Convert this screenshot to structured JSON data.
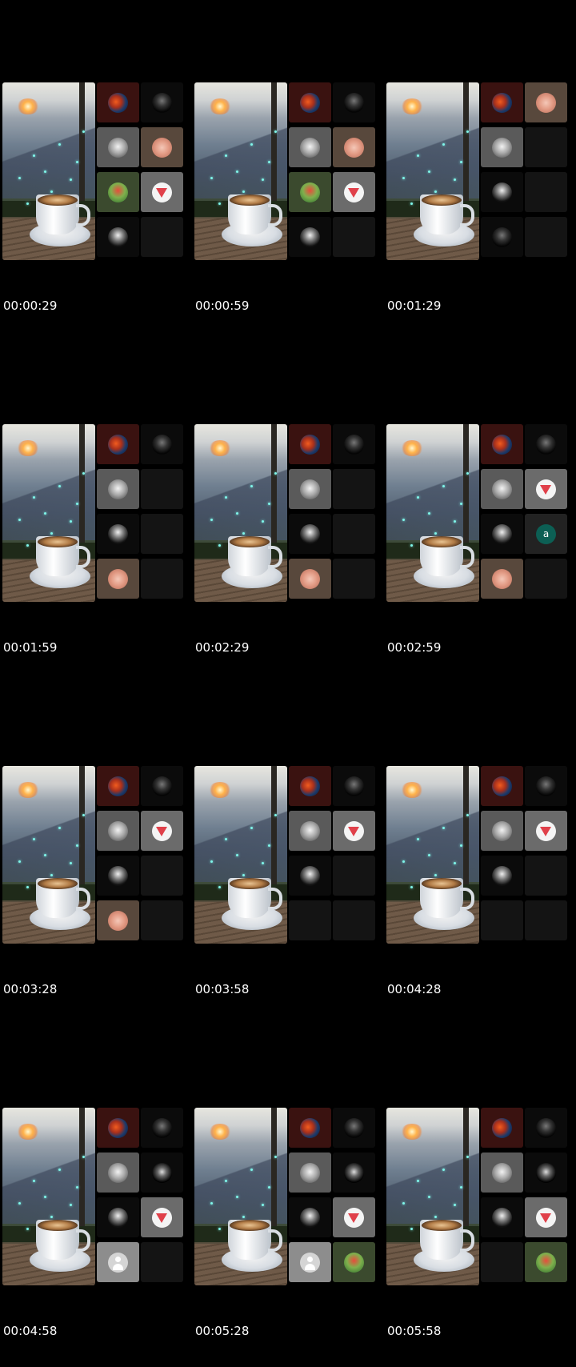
{
  "frames": [
    {
      "timestamp": "00:00:29",
      "tiles": [
        {
          "avatar": "mask",
          "style": "red-tile"
        },
        {
          "avatar": "dark",
          "style": "dark-tile"
        },
        {
          "avatar": "oldman",
          "style": "grey-tile"
        },
        {
          "avatar": "pig",
          "style": "pig-tile"
        },
        {
          "avatar": "mario",
          "style": "mario-tile"
        },
        {
          "avatar": "red",
          "style": "red2-tile"
        },
        {
          "avatar": "girl",
          "style": "dark-tile"
        },
        {
          "avatar": "",
          "style": ""
        }
      ]
    },
    {
      "timestamp": "00:00:59",
      "tiles": [
        {
          "avatar": "mask",
          "style": "red-tile"
        },
        {
          "avatar": "dark",
          "style": "dark-tile"
        },
        {
          "avatar": "oldman",
          "style": "grey-tile"
        },
        {
          "avatar": "pig",
          "style": "pig-tile"
        },
        {
          "avatar": "mario",
          "style": "mario-tile"
        },
        {
          "avatar": "red",
          "style": "red2-tile"
        },
        {
          "avatar": "girl",
          "style": "dark-tile"
        },
        {
          "avatar": "",
          "style": ""
        }
      ]
    },
    {
      "timestamp": "00:01:29",
      "tiles": [
        {
          "avatar": "mask",
          "style": "red-tile"
        },
        {
          "avatar": "pig",
          "style": "pig-tile"
        },
        {
          "avatar": "oldman",
          "style": "grey-tile"
        },
        {
          "avatar": "",
          "style": ""
        },
        {
          "avatar": "girl",
          "style": "dark-tile"
        },
        {
          "avatar": "",
          "style": ""
        },
        {
          "avatar": "dark",
          "style": "dark-tile"
        },
        {
          "avatar": "",
          "style": ""
        }
      ]
    },
    {
      "timestamp": "00:01:59",
      "tiles": [
        {
          "avatar": "mask",
          "style": "red-tile"
        },
        {
          "avatar": "dark",
          "style": "dark-tile"
        },
        {
          "avatar": "oldman",
          "style": "grey-tile"
        },
        {
          "avatar": "",
          "style": ""
        },
        {
          "avatar": "girl",
          "style": "dark-tile"
        },
        {
          "avatar": "",
          "style": ""
        },
        {
          "avatar": "pig",
          "style": "pig-tile"
        },
        {
          "avatar": "",
          "style": ""
        }
      ]
    },
    {
      "timestamp": "00:02:29",
      "tiles": [
        {
          "avatar": "mask",
          "style": "red-tile"
        },
        {
          "avatar": "dark",
          "style": "dark-tile"
        },
        {
          "avatar": "oldman",
          "style": "grey-tile"
        },
        {
          "avatar": "",
          "style": ""
        },
        {
          "avatar": "girl",
          "style": "dark-tile"
        },
        {
          "avatar": "",
          "style": ""
        },
        {
          "avatar": "pig",
          "style": "pig-tile"
        },
        {
          "avatar": "",
          "style": ""
        }
      ]
    },
    {
      "timestamp": "00:02:59",
      "tiles": [
        {
          "avatar": "mask",
          "style": "red-tile"
        },
        {
          "avatar": "dark",
          "style": "dark-tile"
        },
        {
          "avatar": "oldman",
          "style": "grey-tile"
        },
        {
          "avatar": "red",
          "style": "red2-tile"
        },
        {
          "avatar": "girl",
          "style": "dark-tile"
        },
        {
          "avatar": "letter",
          "label": "a",
          "style": "letter-tile"
        },
        {
          "avatar": "pig",
          "style": "pig-tile"
        },
        {
          "avatar": "",
          "style": ""
        }
      ]
    },
    {
      "timestamp": "00:03:28",
      "tiles": [
        {
          "avatar": "mask",
          "style": "red-tile"
        },
        {
          "avatar": "dark",
          "style": "dark-tile"
        },
        {
          "avatar": "oldman",
          "style": "grey-tile"
        },
        {
          "avatar": "red",
          "style": "red2-tile"
        },
        {
          "avatar": "girl",
          "style": "dark-tile"
        },
        {
          "avatar": "",
          "style": ""
        },
        {
          "avatar": "pig",
          "style": "pig-tile"
        },
        {
          "avatar": "",
          "style": ""
        }
      ]
    },
    {
      "timestamp": "00:03:58",
      "tiles": [
        {
          "avatar": "mask",
          "style": "red-tile"
        },
        {
          "avatar": "dark",
          "style": "dark-tile"
        },
        {
          "avatar": "oldman",
          "style": "grey-tile"
        },
        {
          "avatar": "red",
          "style": "red2-tile"
        },
        {
          "avatar": "girl",
          "style": "dark-tile"
        },
        {
          "avatar": "",
          "style": ""
        },
        {
          "avatar": "",
          "style": ""
        },
        {
          "avatar": "",
          "style": ""
        }
      ]
    },
    {
      "timestamp": "00:04:28",
      "tiles": [
        {
          "avatar": "mask",
          "style": "red-tile"
        },
        {
          "avatar": "dark",
          "style": "dark-tile"
        },
        {
          "avatar": "oldman",
          "style": "grey-tile"
        },
        {
          "avatar": "red",
          "style": "red2-tile"
        },
        {
          "avatar": "girl",
          "style": "dark-tile"
        },
        {
          "avatar": "",
          "style": ""
        },
        {
          "avatar": "",
          "style": ""
        },
        {
          "avatar": "",
          "style": ""
        }
      ]
    },
    {
      "timestamp": "00:04:58",
      "tiles": [
        {
          "avatar": "mask",
          "style": "red-tile"
        },
        {
          "avatar": "dark",
          "style": "dark-tile"
        },
        {
          "avatar": "oldman",
          "style": "grey-tile"
        },
        {
          "avatar": "sketch",
          "style": "dark-tile"
        },
        {
          "avatar": "girl",
          "style": "dark-tile"
        },
        {
          "avatar": "red",
          "style": "red2-tile"
        },
        {
          "avatar": "blank",
          "style": "blank-tile"
        },
        {
          "avatar": "",
          "style": ""
        }
      ]
    },
    {
      "timestamp": "00:05:28",
      "tiles": [
        {
          "avatar": "mask",
          "style": "red-tile"
        },
        {
          "avatar": "dark",
          "style": "dark-tile"
        },
        {
          "avatar": "oldman",
          "style": "grey-tile"
        },
        {
          "avatar": "sketch",
          "style": "dark-tile"
        },
        {
          "avatar": "girl",
          "style": "dark-tile"
        },
        {
          "avatar": "red",
          "style": "red2-tile"
        },
        {
          "avatar": "blank",
          "style": "blank-tile"
        },
        {
          "avatar": "mario",
          "style": "mario-tile"
        }
      ]
    },
    {
      "timestamp": "00:05:58",
      "tiles": [
        {
          "avatar": "mask",
          "style": "red-tile"
        },
        {
          "avatar": "dark",
          "style": "dark-tile"
        },
        {
          "avatar": "oldman",
          "style": "grey-tile"
        },
        {
          "avatar": "sketch",
          "style": "dark-tile"
        },
        {
          "avatar": "girl",
          "style": "dark-tile"
        },
        {
          "avatar": "red",
          "style": "red2-tile"
        },
        {
          "avatar": "",
          "style": ""
        },
        {
          "avatar": "mario",
          "style": "mario-tile"
        }
      ]
    }
  ]
}
